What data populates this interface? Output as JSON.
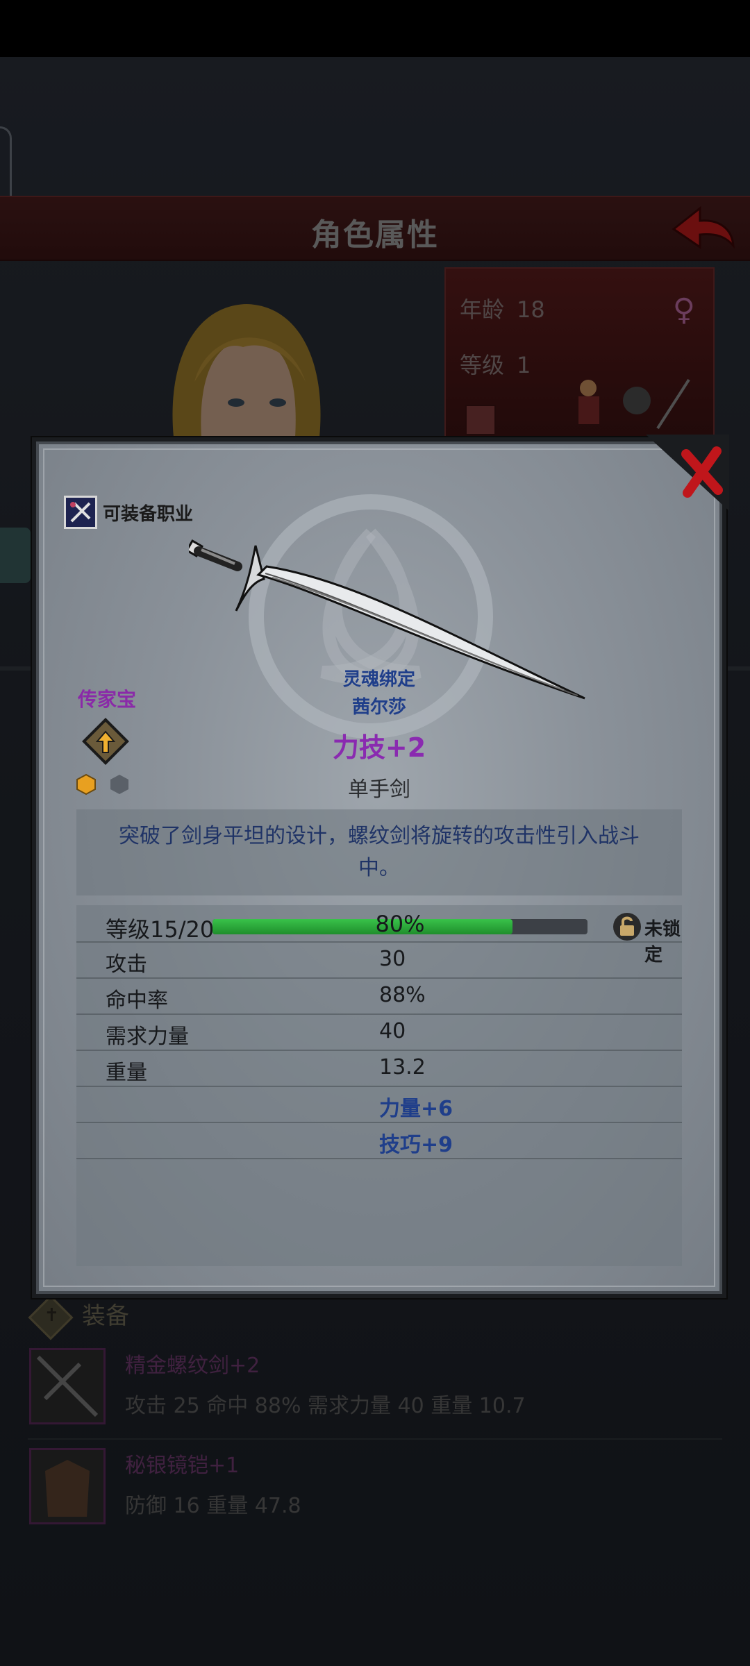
{
  "screen": {
    "title": "角色属性",
    "character": {
      "age_label": "年龄",
      "age": "18",
      "level_label": "等级",
      "level": "1"
    }
  },
  "equipment": {
    "header": "装备",
    "items": [
      {
        "name": "精金螺纹剑+2",
        "stats": "攻击 25 命中 88% 需求力量 40 重量 10.7"
      },
      {
        "name": "秘银镜铠+1",
        "stats": "防御 16 重量 47.8"
      }
    ]
  },
  "popup": {
    "class_button": "可装备职业",
    "soulbound_label": "灵魂绑定",
    "soulbound_to": "茜尔莎",
    "heirloom_label": "传家宝",
    "bonus": "力技+2",
    "weapon_type": "单手剑",
    "description": "突破了剑身平坦的设计，螺纹剑将旋转的攻击性引入战斗中。",
    "level": {
      "label": "等级15/20",
      "progress_text": "80%",
      "progress": 0.8,
      "lock_text": "未锁定"
    },
    "stats": [
      {
        "name": "攻击",
        "value": "30"
      },
      {
        "name": "命中率",
        "value": "88%"
      },
      {
        "name": "需求力量",
        "value": "40"
      },
      {
        "name": "重量",
        "value": "13.2"
      }
    ],
    "bonuses": [
      "力量+6",
      "技巧+9"
    ]
  },
  "colors": {
    "accent_red": "#c0161b",
    "progress_green": "#2eb43e",
    "bonus_purple": "#8a2ab0",
    "bonus_blue": "#1f3e8a"
  }
}
